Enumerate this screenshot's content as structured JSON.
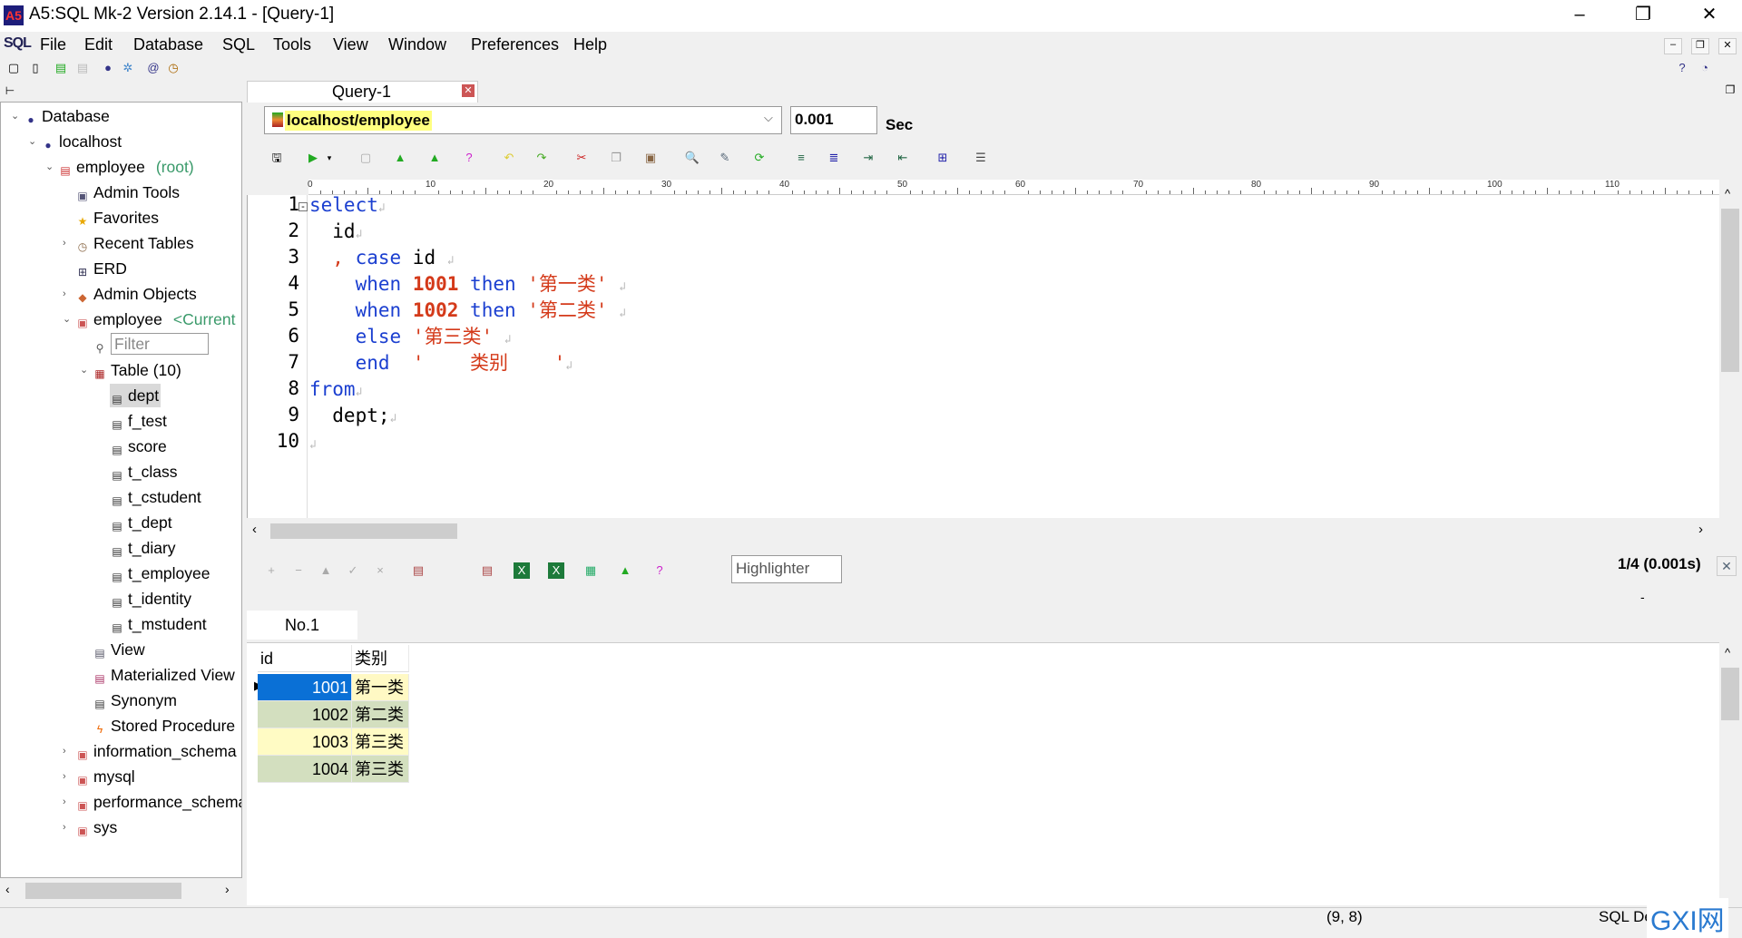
{
  "window": {
    "title": "A5:SQL Mk-2 Version 2.14.1 - [Query-1]",
    "app_icon": "A5"
  },
  "menu": {
    "icon": "SQL",
    "items": [
      "File",
      "Edit",
      "Database",
      "SQL",
      "Tools",
      "View",
      "Window",
      "Preferences",
      "Help"
    ]
  },
  "tree": {
    "items": [
      {
        "label": "Database",
        "level": 0,
        "icon": "database-icon",
        "expanded": true
      },
      {
        "label": "localhost",
        "level": 1,
        "icon": "server-icon",
        "expanded": true
      },
      {
        "label": "employee",
        "suffix": "(root)",
        "level": 2,
        "icon": "connection-icon",
        "expanded": true
      },
      {
        "label": "Admin Tools",
        "level": 3,
        "icon": "admin-tools-icon"
      },
      {
        "label": "Favorites",
        "level": 3,
        "icon": "star-icon"
      },
      {
        "label": "Recent Tables",
        "level": 3,
        "icon": "clock-icon",
        "collapsed": true
      },
      {
        "label": "ERD",
        "level": 3,
        "icon": "erd-icon"
      },
      {
        "label": "Admin Objects",
        "level": 3,
        "icon": "admin-objects-icon",
        "collapsed": true
      },
      {
        "label": "employee",
        "suffix": "<Current",
        "level": 3,
        "icon": "schema-icon",
        "expanded": true
      },
      {
        "label": "Filter",
        "level": 4,
        "icon": "search-icon",
        "filter": true
      },
      {
        "label": "Table (10)",
        "level": 4,
        "icon": "table-group-icon",
        "expanded": true
      },
      {
        "label": "dept",
        "level": 5,
        "icon": "table-icon",
        "selected": true
      },
      {
        "label": "f_test",
        "level": 5,
        "icon": "table-icon"
      },
      {
        "label": "score",
        "level": 5,
        "icon": "table-icon"
      },
      {
        "label": "t_class",
        "level": 5,
        "icon": "table-icon"
      },
      {
        "label": "t_cstudent",
        "level": 5,
        "icon": "table-icon"
      },
      {
        "label": "t_dept",
        "level": 5,
        "icon": "table-icon"
      },
      {
        "label": "t_diary",
        "level": 5,
        "icon": "table-icon"
      },
      {
        "label": "t_employee",
        "level": 5,
        "icon": "table-icon"
      },
      {
        "label": "t_identity",
        "level": 5,
        "icon": "table-icon"
      },
      {
        "label": "t_mstudent",
        "level": 5,
        "icon": "table-icon"
      },
      {
        "label": "View",
        "level": 4,
        "icon": "view-icon"
      },
      {
        "label": "Materialized View",
        "level": 4,
        "icon": "mview-icon"
      },
      {
        "label": "Synonym",
        "level": 4,
        "icon": "synonym-icon"
      },
      {
        "label": "Stored Procedure",
        "level": 4,
        "icon": "procedure-icon"
      },
      {
        "label": "information_schema",
        "level": 3,
        "icon": "schema-icon",
        "collapsed": true
      },
      {
        "label": "mysql",
        "level": 3,
        "icon": "schema-icon",
        "collapsed": true
      },
      {
        "label": "performance_schema",
        "level": 3,
        "icon": "schema-icon",
        "collapsed": true
      },
      {
        "label": "sys",
        "level": 3,
        "icon": "schema-icon",
        "collapsed": true
      }
    ]
  },
  "query": {
    "tab": "Query-1",
    "connection": "localhost/employee",
    "time_value": "0.001",
    "time_unit": "Sec"
  },
  "ruler": [
    "0",
    "10",
    "20",
    "30",
    "40",
    "50",
    "60",
    "70",
    "80",
    "90",
    "100",
    "110"
  ],
  "editor": {
    "lines": [
      [
        [
          "kw",
          "select"
        ]
      ],
      [
        [
          "",
          "  id"
        ]
      ],
      [
        [
          "str",
          "  , "
        ],
        [
          "kw",
          "case"
        ],
        [
          "",
          " id "
        ]
      ],
      [
        [
          "",
          "    "
        ],
        [
          "kw",
          "when"
        ],
        [
          "",
          " "
        ],
        [
          "num",
          "1001"
        ],
        [
          "",
          " "
        ],
        [
          "kw",
          "then"
        ],
        [
          "",
          " "
        ],
        [
          "str",
          "'第一类'"
        ],
        [
          "",
          " "
        ]
      ],
      [
        [
          "",
          "    "
        ],
        [
          "kw",
          "when"
        ],
        [
          "",
          " "
        ],
        [
          "num",
          "1002"
        ],
        [
          "",
          " "
        ],
        [
          "kw",
          "then"
        ],
        [
          "",
          " "
        ],
        [
          "str",
          "'第二类'"
        ],
        [
          "",
          " "
        ]
      ],
      [
        [
          "",
          "    "
        ],
        [
          "kw",
          "else"
        ],
        [
          "",
          " "
        ],
        [
          "str",
          "'第三类'"
        ],
        [
          "",
          " "
        ]
      ],
      [
        [
          "",
          "    "
        ],
        [
          "kw",
          "end"
        ],
        [
          "",
          "  "
        ],
        [
          "str",
          "'    类别    '"
        ]
      ],
      [
        [
          "kw",
          "from"
        ]
      ],
      [
        [
          "",
          "  dept;"
        ]
      ],
      []
    ]
  },
  "results": {
    "highlighter_placeholder": "Highlighter",
    "count": "1/4 (0.001s)",
    "dash": "-",
    "tab": "No.1",
    "columns": [
      "id",
      "类别"
    ],
    "rows": [
      [
        "1001",
        "第一类"
      ],
      [
        "1002",
        "第二类"
      ],
      [
        "1003",
        "第三类"
      ],
      [
        "1004",
        "第三类"
      ]
    ]
  },
  "status": {
    "position": "(9, 8)",
    "mode": "SQL De"
  },
  "watermark": "GXI网 system.com"
}
